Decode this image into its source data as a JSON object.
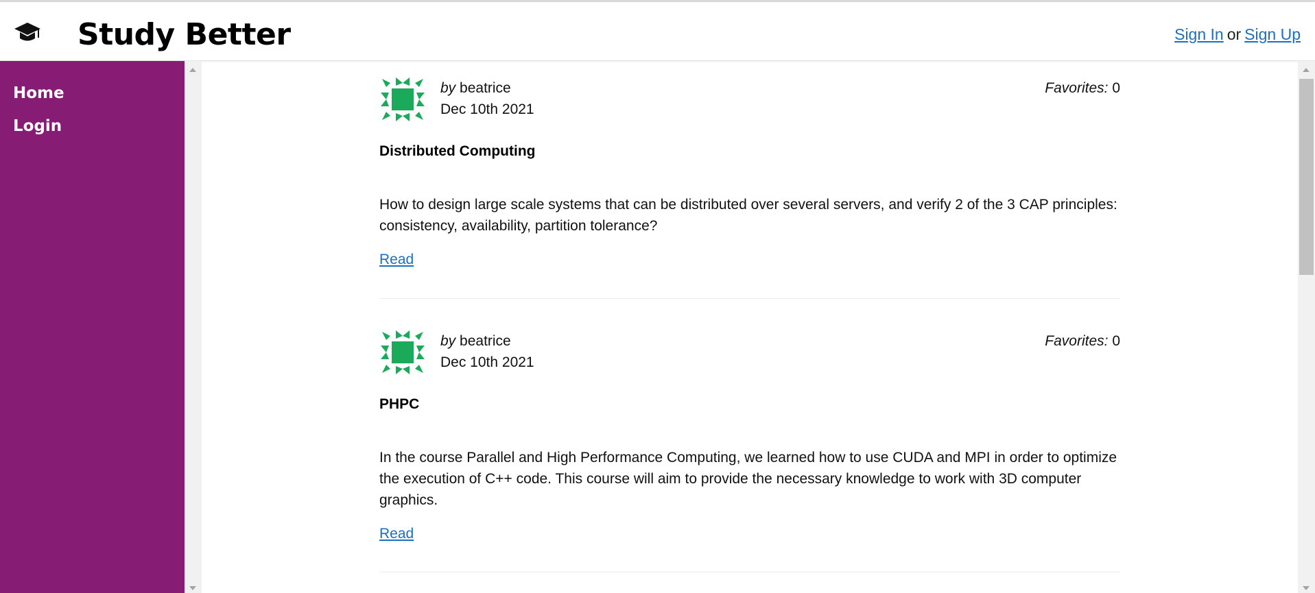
{
  "header": {
    "title": "Study Better",
    "logo_icon": "graduation-cap-icon",
    "auth": {
      "sign_in": "Sign In",
      "separator": "or",
      "sign_up": "Sign Up"
    }
  },
  "sidebar": {
    "items": [
      {
        "label": "Home"
      },
      {
        "label": "Login"
      }
    ]
  },
  "posts": [
    {
      "by_label": "by",
      "author": "beatrice",
      "date": "Dec 10th 2021",
      "favorites_label": "Favorites:",
      "favorites": "0",
      "title": "Distributed Computing",
      "description": "How to design large scale systems that can be distributed over several servers, and verify 2 of the 3 CAP principles: consistency, availability, partition tolerance?",
      "read_label": "Read"
    },
    {
      "by_label": "by",
      "author": "beatrice",
      "date": "Dec 10th 2021",
      "favorites_label": "Favorites:",
      "favorites": "0",
      "title": "PHPC",
      "description": "In the course Parallel and High Performance Computing, we learned how to use CUDA and MPI in order to optimize the execution of C++ code. This course will aim to provide the necessary knowledge to work with 3D computer graphics.",
      "read_label": "Read"
    }
  ],
  "colors": {
    "sidebar": "#861c74",
    "link": "#1a6fc4",
    "avatar": "#1aaa5a"
  }
}
